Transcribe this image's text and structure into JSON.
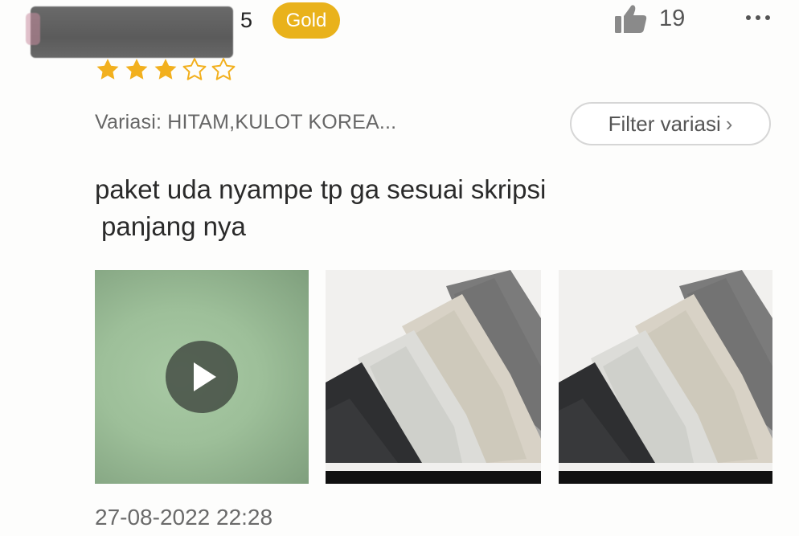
{
  "review": {
    "username_visible_suffix": "5",
    "badge": "Gold",
    "rating": 3,
    "rating_max": 5,
    "likes": "19",
    "variation": "Variasi: HITAM,KULOT KOREA...",
    "filter_button": "Filter variasi",
    "filter_chevron": "›",
    "text_line1": "paket uda nyampe tp ga sesuai skripsi",
    "text_line2": "panjang nya",
    "timestamp": "27-08-2022 22:28"
  },
  "colors": {
    "badge_gold": "#e9b21b",
    "star_filled": "#f2b01e",
    "star_empty_stroke": "#f2b01e"
  },
  "icons": {
    "like": "thumbs-up-icon",
    "more": "more-dots-icon",
    "play": "play-icon"
  },
  "media": [
    {
      "type": "video"
    },
    {
      "type": "photo",
      "subject": "folded trousers"
    },
    {
      "type": "photo",
      "subject": "folded trousers"
    }
  ]
}
